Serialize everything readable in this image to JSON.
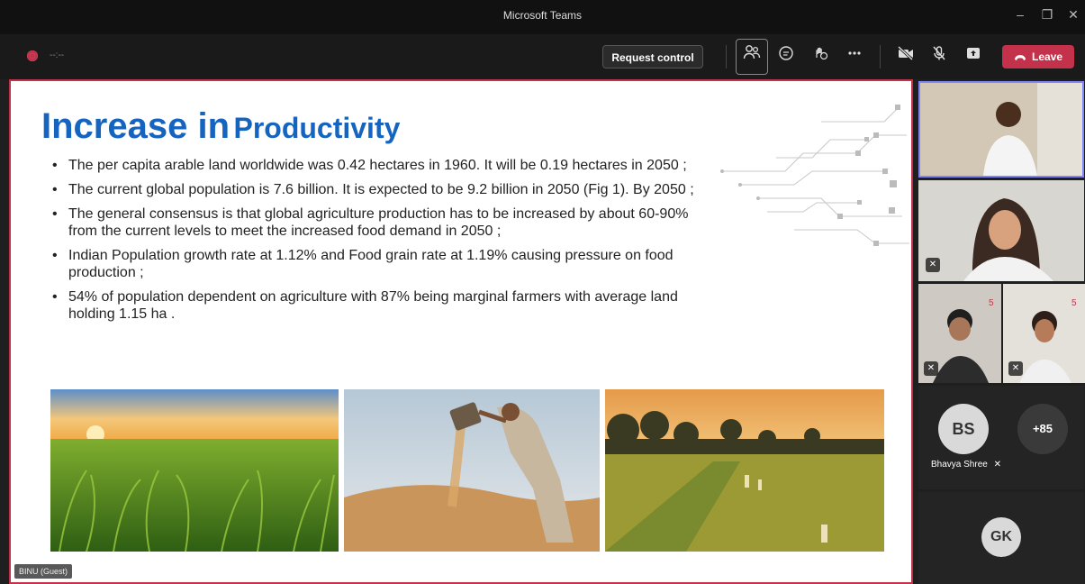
{
  "window": {
    "title": "Microsoft Teams",
    "minimize": "–",
    "restore": "❐",
    "close": "✕"
  },
  "toolbar": {
    "recording_timer": "--:--",
    "request_control": "Request control",
    "leave": "Leave",
    "icons": [
      "participants-icon",
      "chat-icon",
      "reactions-icon",
      "more-icon",
      "camera-off-icon",
      "mic-off-icon",
      "share-icon"
    ]
  },
  "slide": {
    "title_part1": "Increase in",
    "title_part2": "Productivity",
    "bullets": [
      "The per capita arable land worldwide was 0.42 hectares in 1960. It will be 0.19 hectares in 2050 ;",
      "The current global population is 7.6 billion. It is expected to be 9.2 billion in 2050 (Fig 1). By 2050 ;",
      "The general consensus is that global agriculture production has to be increased by about 60-90% from the current levels to meet the increased food demand in 2050 ;",
      "Indian Population growth rate at 1.12% and Food grain rate at 1.19% causing pressure on food production ;",
      "54% of population dependent on agriculture with 87% being marginal farmers with average land holding 1.15 ha ."
    ],
    "presenter_label": "BINU (Guest)"
  },
  "participants": {
    "bs_initials": "BS",
    "bs_name": "Bhavya Shree",
    "overflow_count": "+85",
    "gk_initials": "GK"
  },
  "colors": {
    "accent": "#c4314b",
    "slide_title": "#1565c0"
  }
}
